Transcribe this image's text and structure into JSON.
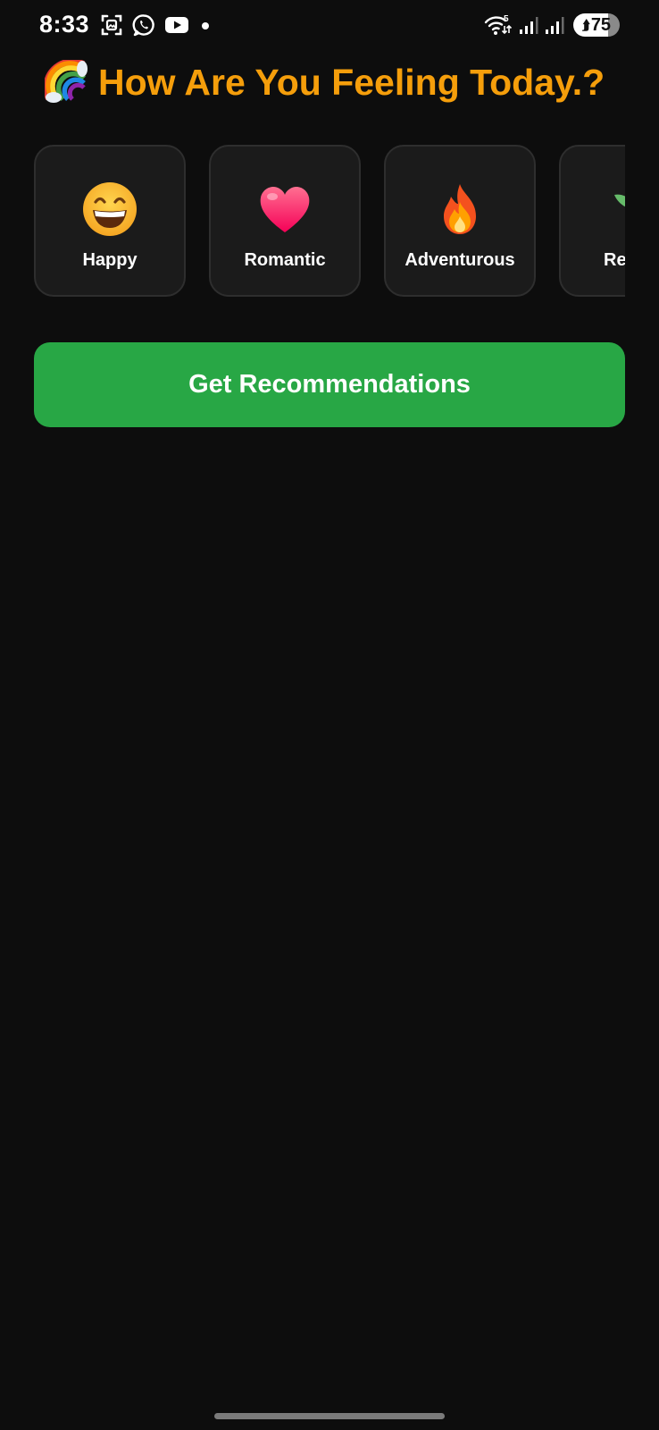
{
  "status_bar": {
    "time": "8:33",
    "left_icons": [
      "screenshot-icon",
      "whatsapp-icon",
      "youtube-icon",
      "notification-dot-icon"
    ],
    "right_icons": [
      "wifi-icon",
      "signal-icon",
      "signal-icon"
    ],
    "wifi_badge": "5",
    "battery_level": "75"
  },
  "header": {
    "emoji": "rainbow",
    "title": "How Are You Feeling Today.?"
  },
  "moods": [
    {
      "label": "Happy",
      "emoji": "grinning-face"
    },
    {
      "label": "Romantic",
      "emoji": "heart"
    },
    {
      "label": "Adventurous",
      "emoji": "fire"
    },
    {
      "label": "Re",
      "emoji": "seedling"
    }
  ],
  "cta": {
    "label": "Get Recommendations"
  },
  "colors": {
    "background": "#0d0d0d",
    "title": "#f59e0b",
    "card_bg": "#1b1b1b",
    "card_border": "#2e2e2e",
    "cta_bg": "#28a745"
  }
}
